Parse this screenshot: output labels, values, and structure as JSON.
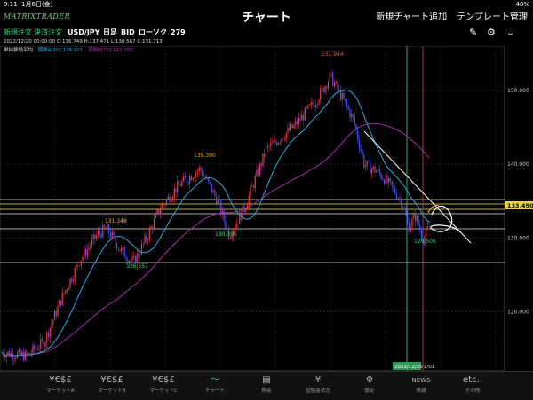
{
  "statusbar": {
    "time": "9:11",
    "date": "1月6日(金)",
    "battery": "48%"
  },
  "header": {
    "logo": "MATRIXTRADER",
    "title": "チャート",
    "add_chart": "新規チャート追加",
    "template": "テンプレート管理"
  },
  "toolbar": {
    "new_order": "新規注文",
    "settle_order": "決済注文",
    "pair": "USD/JPY",
    "period": "日足",
    "side": "BID",
    "type": "ローソク",
    "count": "279"
  },
  "infoline": {
    "ohlc": "2022/12/20 00:00:00   O:136.749   H:137.471   L:130.567   C:131.713",
    "ma_label": "単純移動平均",
    "ma_a": "期間A[20]  136.901",
    "ma_b": "期間B[75]  142.260"
  },
  "colors": {
    "bull": "#ff3b3b",
    "bear": "#4a56ff",
    "ma_a": "#29a8e0",
    "ma_b": "#a52aa5",
    "green_line": "#37d67a",
    "accent": "#37d67a"
  },
  "chart_data": {
    "type": "candlestick",
    "yaxis": {
      "ticks": [
        "150.000",
        "140.000",
        "130.000",
        "120.000"
      ],
      "range": [
        112,
        156
      ]
    },
    "annotations": {
      "high": "151.944",
      "mid_high": "139.390",
      "mid_low": "130.395",
      "early_high": "131.348",
      "early_low": "126.557",
      "recent_low": "129.506"
    },
    "last_price": "133.450",
    "date_label": "2022/12/20",
    "date_label_right": "1/01"
  },
  "nav": {
    "items": [
      {
        "icon": "¥€$£",
        "label": "マーケットA"
      },
      {
        "icon": "¥€$£",
        "label": "マーケットB"
      },
      {
        "icon": "¥€$£",
        "label": "マーケットC"
      },
      {
        "icon": "〜",
        "label": "チャート"
      },
      {
        "icon": "▤",
        "label": "照会"
      },
      {
        "icon": "¥",
        "label": "証拠金状況"
      },
      {
        "icon": "⚙",
        "label": "設定"
      },
      {
        "icon": "NEWS",
        "label": "情報"
      },
      {
        "icon": "etc..",
        "label": "その他"
      }
    ]
  }
}
